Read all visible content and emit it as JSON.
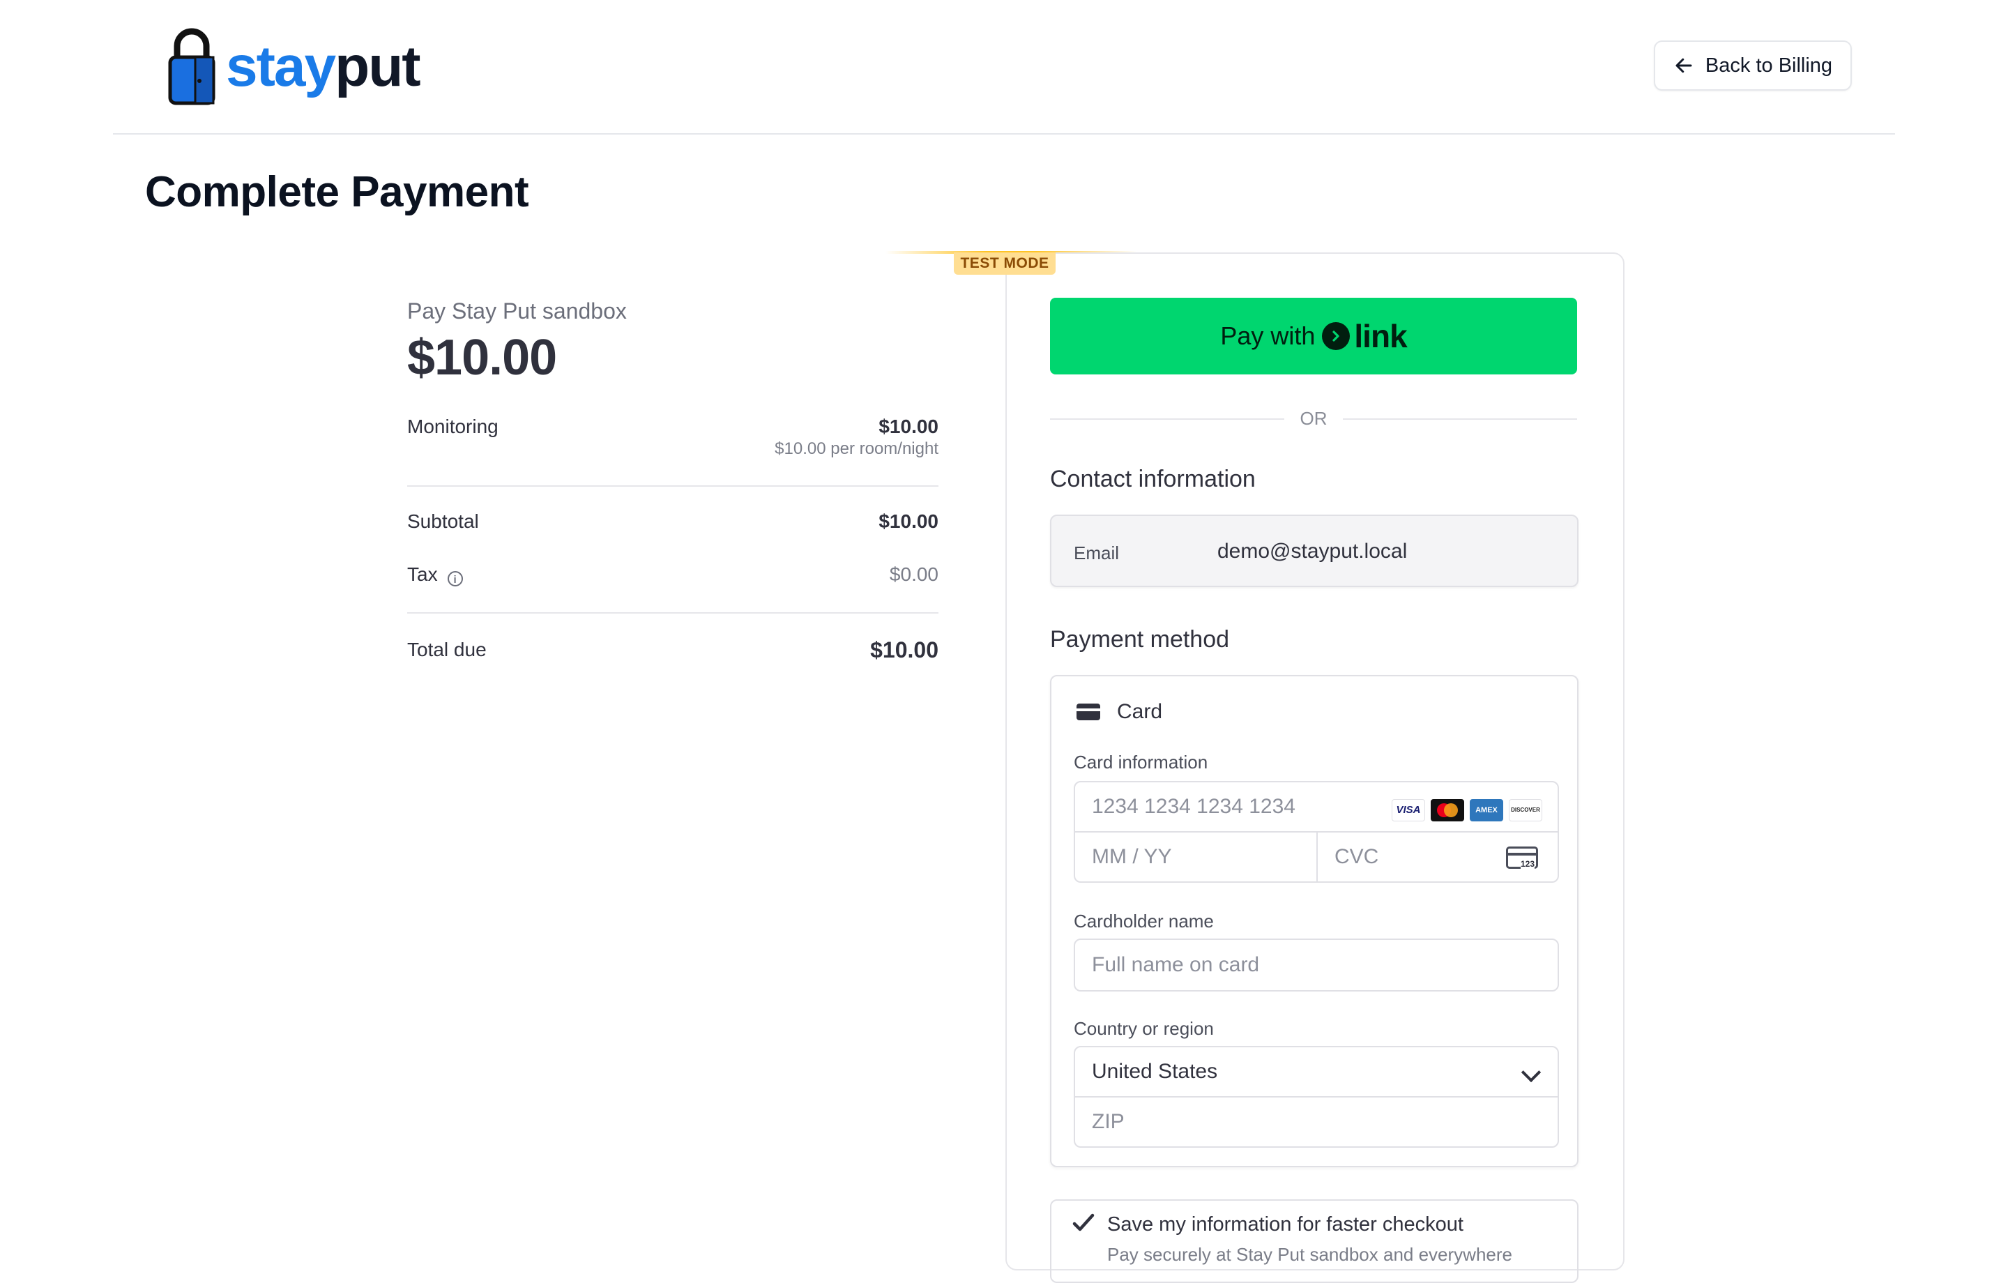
{
  "header": {
    "logo": {
      "part1": "stay",
      "part2": "put",
      "colors": {
        "stay": "#1a7be8",
        "put": "#111827",
        "lock_body": "#1a6fe0"
      }
    },
    "back_button": {
      "label": "Back to Billing",
      "icon": "arrow-left-icon"
    }
  },
  "page": {
    "title": "Complete Payment"
  },
  "summary": {
    "pay_to": "Pay Stay Put sandbox",
    "amount": "$10.00",
    "line_items": [
      {
        "name": "Monitoring",
        "amount": "$10.00",
        "detail": "$10.00 per room/night"
      }
    ],
    "subtotal_label": "Subtotal",
    "subtotal_value": "$10.00",
    "tax_label": "Tax",
    "tax_value": "$0.00",
    "total_label": "Total due",
    "total_value": "$10.00"
  },
  "test_mode": {
    "label": "TEST MODE",
    "color": "#ffde92"
  },
  "checkout": {
    "link_button": {
      "prefix": "Pay with",
      "brand": "link",
      "color": "#00d66f"
    },
    "or_label": "OR",
    "contact": {
      "title": "Contact information",
      "email_label": "Email",
      "email_value": "demo@stayput.local"
    },
    "payment": {
      "title": "Payment method",
      "method_label": "Card",
      "card_info_label": "Card information",
      "card_number_placeholder": "1234 1234 1234 1234",
      "card_brands": [
        "VISA",
        "Mastercard",
        "AMEX",
        "DISCOVER"
      ],
      "expiry_placeholder": "MM / YY",
      "cvc_placeholder": "CVC",
      "cvc_icon_text": "123",
      "cardholder_label": "Cardholder name",
      "cardholder_placeholder": "Full name on card",
      "country_label": "Country or region",
      "country_value": "United States",
      "zip_placeholder": "ZIP"
    },
    "save_info": {
      "checked": true,
      "label": "Save my information for faster checkout",
      "sublabel": "Pay securely at Stay Put sandbox and everywhere"
    }
  }
}
